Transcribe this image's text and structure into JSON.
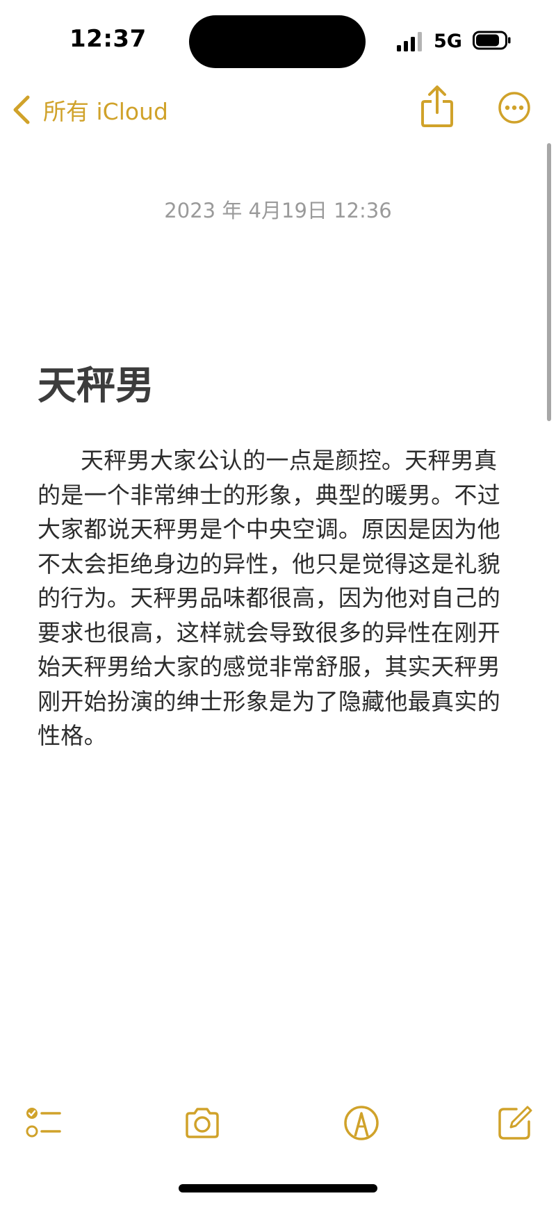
{
  "status_bar": {
    "time": "12:37",
    "network": "5G",
    "icons": [
      "signal-icon",
      "battery-icon"
    ]
  },
  "nav": {
    "back_label": "所有 iCloud",
    "back_icon": "chevron-left-icon",
    "share_icon": "share-icon",
    "more_icon": "more-icon"
  },
  "note": {
    "date": "2023 年 4月19日 12:36",
    "title": "天秤男",
    "body": "天秤男大家公认的一点是颜控。天秤男真的是一个非常绅士的形象，典型的暖男。不过大家都说天秤男是个中央空调。原因是因为他不太会拒绝身边的异性，他只是觉得这是礼貌的行为。天秤男品味都很高，因为他对自己的要求也很高，这样就会导致很多的异性在刚开始天秤男给大家的感觉非常舒服，其实天秤男刚开始扮演的绅士形象是为了隐藏他最真实的性格。"
  },
  "toolbar": {
    "icons": [
      "checklist-icon",
      "camera-icon",
      "markup-icon",
      "compose-icon"
    ]
  },
  "colors": {
    "accent": "#d0a22a",
    "date_text": "#9a9a9a",
    "title_text": "#3c3c3c",
    "body_text": "#2c2c2c"
  }
}
